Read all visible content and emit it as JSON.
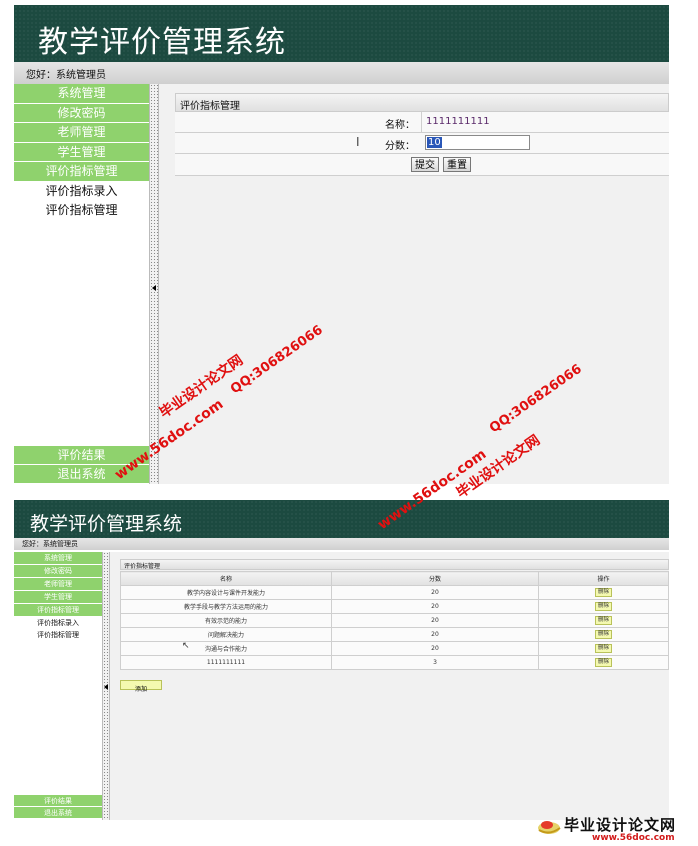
{
  "app": {
    "title": "教学评价管理系统",
    "greeting": "您好：系统管理员"
  },
  "sidebar": {
    "items": [
      "系统管理",
      "修改密码",
      "老师管理",
      "学生管理",
      "评价指标管理"
    ],
    "sub_items": [
      "评价指标录入",
      "评价指标管理"
    ],
    "bottom_items": [
      "评价结果",
      "退出系统"
    ]
  },
  "edit_form": {
    "panel_title": "评价指标管理",
    "name_label": "名称：",
    "name_value": "1111111111",
    "score_label": "分数：",
    "score_value": "10",
    "submit_label": "提交",
    "reset_label": "重置"
  },
  "list_view": {
    "panel_title": "评价指标管理",
    "columns": [
      "名称",
      "分数",
      "操作"
    ],
    "rows": [
      {
        "name": "教学内容设计与课件开发能力",
        "score": "20",
        "action": "删除"
      },
      {
        "name": "教学手段与教学方法运用的能力",
        "score": "20",
        "action": "删除"
      },
      {
        "name": "有效示范的能力",
        "score": "20",
        "action": "删除"
      },
      {
        "name": "问题解决能力",
        "score": "20",
        "action": "删除"
      },
      {
        "name": "沟通与合作能力",
        "score": "20",
        "action": "删除"
      },
      {
        "name": "1111111111",
        "score": "3",
        "action": "删除"
      }
    ],
    "add_label": "添加"
  },
  "watermarks": {
    "site_cn": "毕业设计论文网",
    "site_url": "www.56doc.com",
    "qq": "QQ:306826066",
    "footer_logo_cn": "毕业设计论文网",
    "footer_logo_url": "www.56doc.com"
  },
  "colors": {
    "banner": "#1c4a40",
    "nav_green": "#8fd26d",
    "watermark_red": "#e01010",
    "delete_button": "#f4f9b0"
  }
}
